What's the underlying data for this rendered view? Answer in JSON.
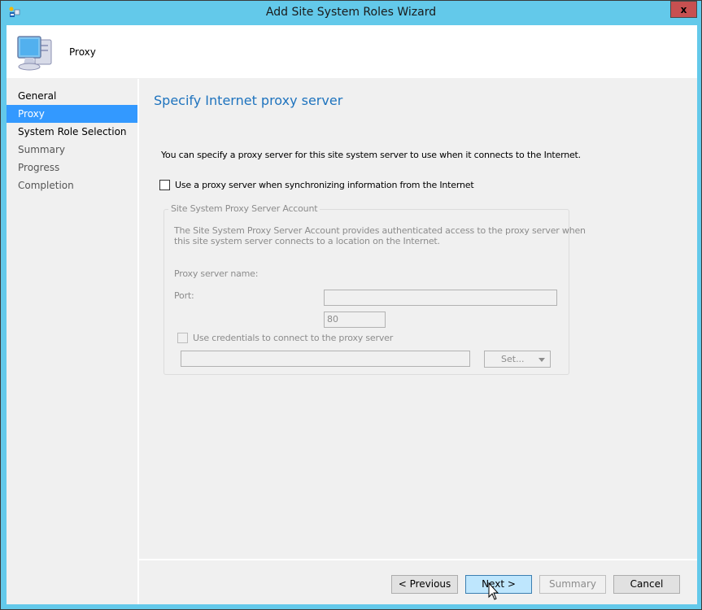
{
  "window": {
    "title": "Add Site System Roles Wizard",
    "close_label": "x"
  },
  "header": {
    "title": "Proxy"
  },
  "nav": {
    "items": [
      {
        "label": "General",
        "state": "completed"
      },
      {
        "label": "Proxy",
        "state": "active"
      },
      {
        "label": "System Role Selection",
        "state": "completed"
      },
      {
        "label": "Summary",
        "state": "pending"
      },
      {
        "label": "Progress",
        "state": "pending"
      },
      {
        "label": "Completion",
        "state": "pending"
      }
    ]
  },
  "page": {
    "title": "Specify Internet proxy server",
    "description": "You can specify a proxy server for this site system server to use when it connects to the Internet.",
    "use_proxy_label": "Use a proxy server when synchronizing information from the Internet",
    "use_proxy_checked": false,
    "group": {
      "legend": "Site System Proxy Server Account",
      "description_line1": "The Site System Proxy Server Account provides authenticated access to the proxy server when",
      "description_line2": "this site system server connects to a location on the Internet.",
      "proxy_name_label": "Proxy server name:",
      "proxy_name_value": "",
      "port_label": "Port:",
      "port_value": "80",
      "use_credentials_label": "Use credentials to connect to the proxy server",
      "use_credentials_checked": false,
      "account_value": "",
      "set_label": "Set..."
    }
  },
  "footer": {
    "previous_label": "< Previous",
    "next_label": "Next >",
    "summary_label": "Summary",
    "cancel_label": "Cancel"
  }
}
